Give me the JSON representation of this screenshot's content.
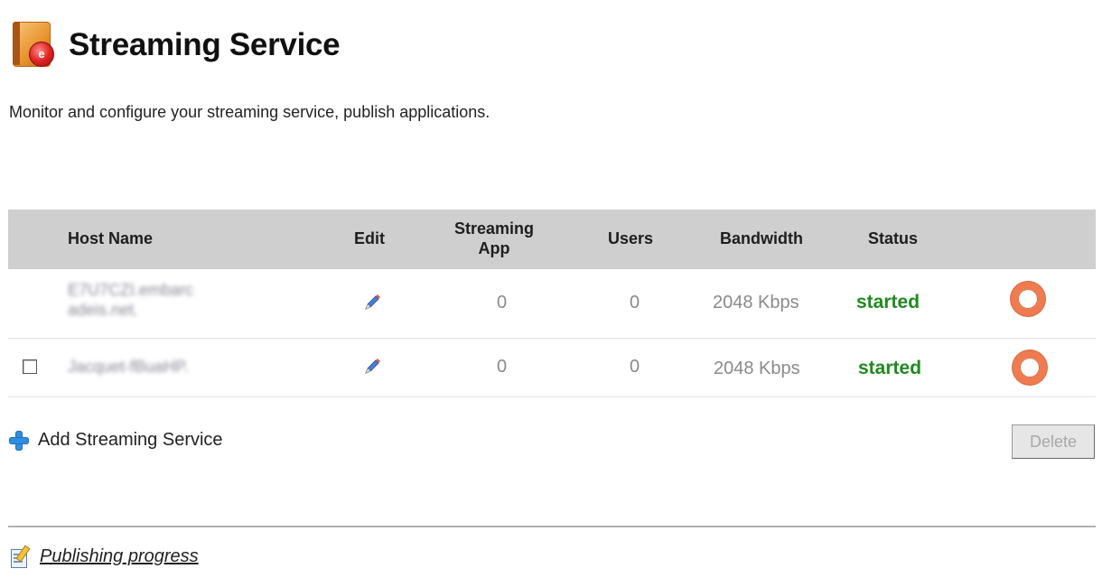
{
  "header": {
    "title": "Streaming Service",
    "icon": "streaming-service-icon"
  },
  "description": "Monitor and configure your streaming service, publish applications.",
  "table": {
    "columns": {
      "host_name": "Host Name",
      "edit": "Edit",
      "streaming_app_line1": "Streaming",
      "streaming_app_line2": "App",
      "users": "Users",
      "bandwidth": "Bandwidth",
      "status": "Status"
    },
    "rows": [
      {
        "host_line1": "E7U7CZI.embarc",
        "host_line2": "adeis.net.",
        "streaming_app": "0",
        "users": "0",
        "bandwidth": "2048 Kbps",
        "status": "started",
        "has_checkbox": false
      },
      {
        "host_line1": "Jacquet-fBuaHP.",
        "host_line2": "",
        "streaming_app": "0",
        "users": "0",
        "bandwidth": "2048 Kbps",
        "status": "started",
        "has_checkbox": true
      }
    ]
  },
  "actions": {
    "add_label": "Add Streaming Service",
    "delete_label": "Delete"
  },
  "footer": {
    "publishing_label": "Publishing progress"
  },
  "colors": {
    "header_bg": "#cfcfcf",
    "status_started": "#1f8a1f",
    "ring": "#ef7b51",
    "plus": "#2e8fe0"
  }
}
